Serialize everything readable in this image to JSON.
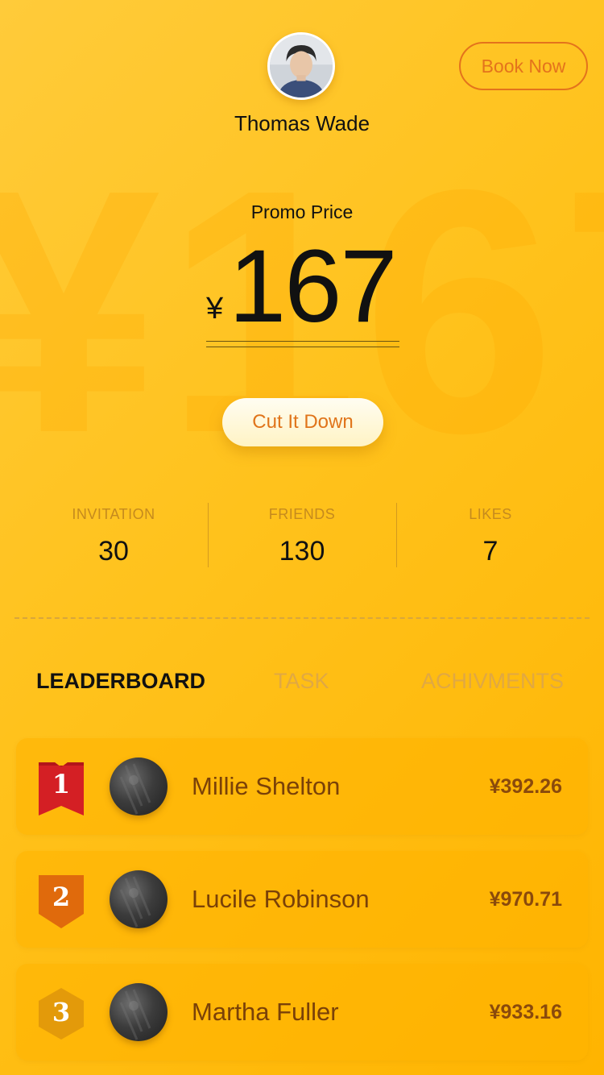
{
  "profile": {
    "name": "Thomas Wade",
    "avatar_icon": "person-photo"
  },
  "header": {
    "book_now_label": "Book Now"
  },
  "promo": {
    "label": "Promo Price",
    "currency": "¥",
    "price": "167",
    "background_text": "¥167",
    "cut_button_label": "Cut It Down"
  },
  "stats": [
    {
      "label": "INVITATION",
      "value": "30"
    },
    {
      "label": "FRIENDS",
      "value": "130"
    },
    {
      "label": "LIKES",
      "value": "7"
    }
  ],
  "tabs": [
    {
      "label": "LEADERBOARD",
      "active": true
    },
    {
      "label": "TASK",
      "active": false
    },
    {
      "label": "ACHIVMENTS",
      "active": false
    }
  ],
  "leaderboard": [
    {
      "rank": "1",
      "name": "Millie Shelton",
      "amount": "¥392.26",
      "badge_color": "#d41f24",
      "badge_icon": "ribbon-icon"
    },
    {
      "rank": "2",
      "name": "Lucile Robinson",
      "amount": "¥970.71",
      "badge_color": "#e06a0c",
      "badge_icon": "shield-icon"
    },
    {
      "rank": "3",
      "name": "Martha Fuller",
      "amount": "¥933.16",
      "badge_color": "#e39a0a",
      "badge_icon": "hexagon-icon"
    }
  ],
  "colors": {
    "accent": "#e4731c",
    "background_start": "#ffcb3a",
    "background_end": "#ffb400"
  }
}
